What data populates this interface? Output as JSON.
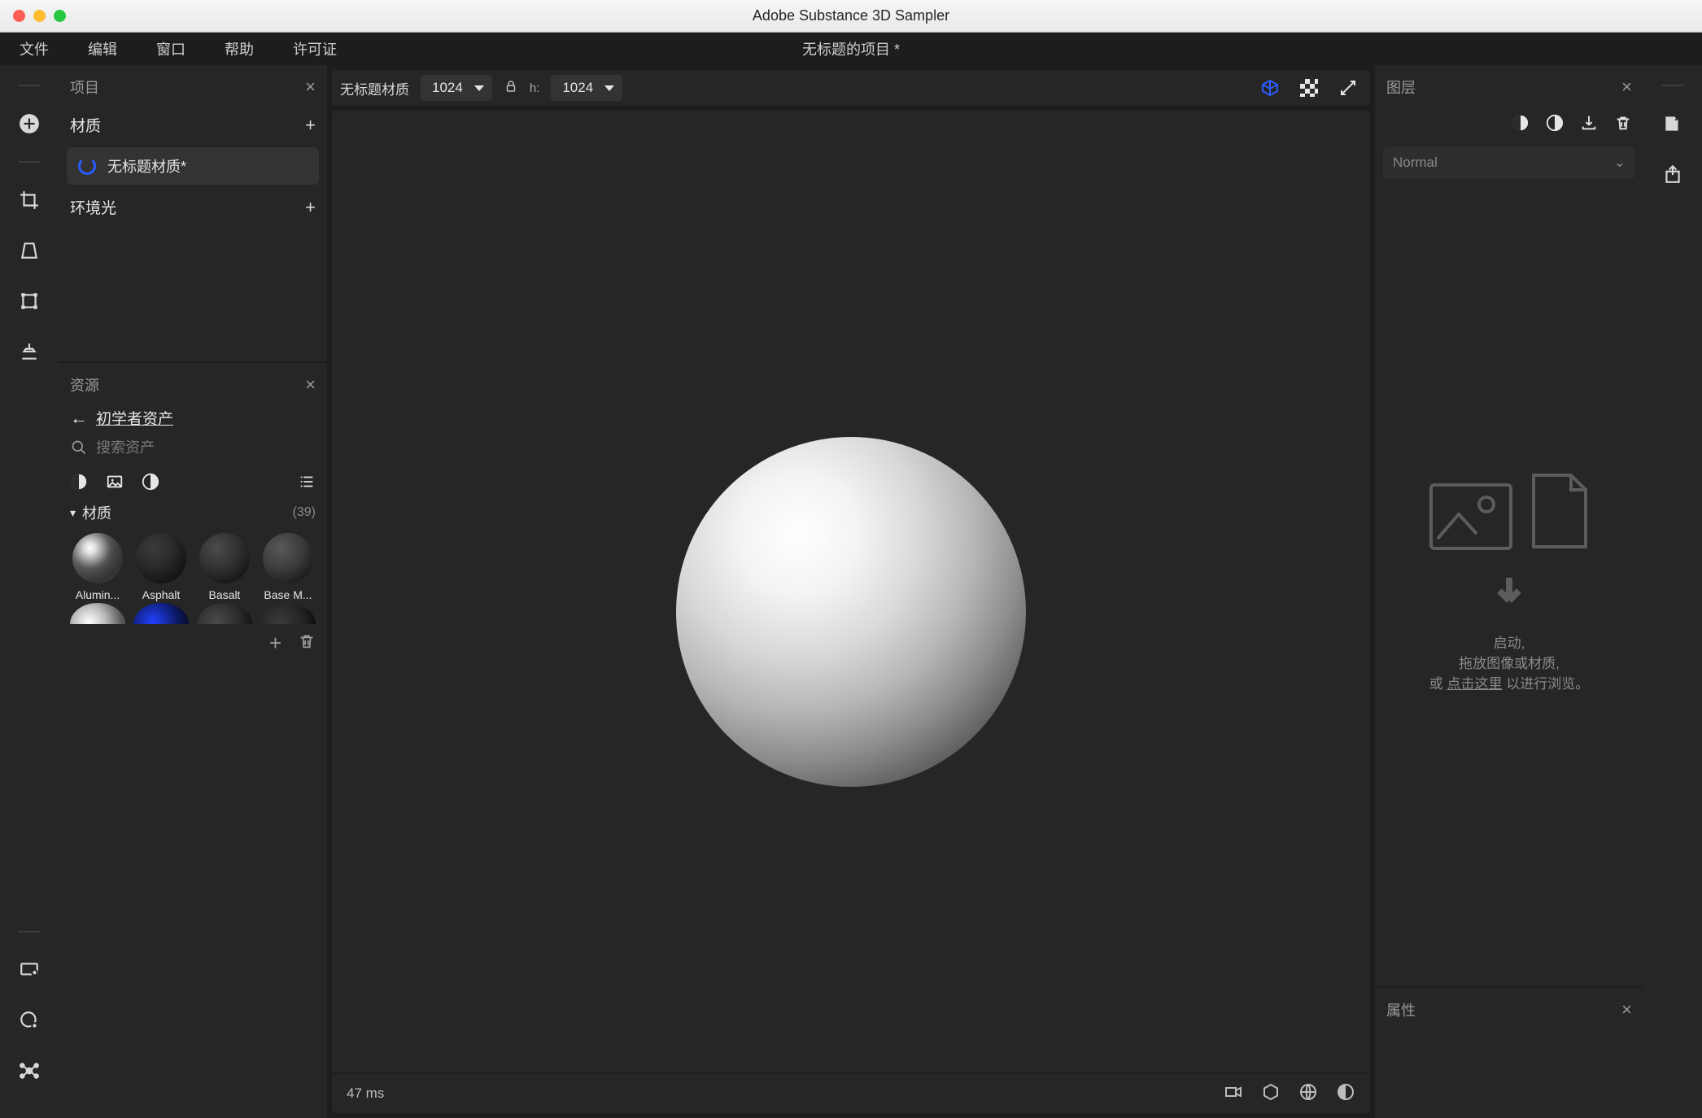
{
  "window": {
    "title": "Adobe Substance 3D Sampler"
  },
  "menubar": {
    "items": [
      "文件",
      "编辑",
      "窗口",
      "帮助",
      "许可证"
    ],
    "project_title": "无标题的项目 *"
  },
  "project_panel": {
    "title": "项目",
    "materials_header": "材质",
    "material_item": "无标题材质*",
    "env_header": "环境光"
  },
  "assets_panel": {
    "title": "资源",
    "back_label": "初学者资产",
    "search_placeholder": "搜索资产",
    "category_label": "材质",
    "category_count": "(39)",
    "thumbs": [
      "Alumin...",
      "Asphalt",
      "Basalt",
      "Base M..."
    ]
  },
  "viewport": {
    "material_name": "无标题材质",
    "link_locked": true,
    "width_value": "1024",
    "height_label": "h:",
    "height_value": "1024",
    "status_ms": "47 ms"
  },
  "layers_panel": {
    "title": "图层",
    "blend_mode": "Normal",
    "drop_text_1": "启动,",
    "drop_text_2": "拖放图像或材质,",
    "drop_text_3_pre": "或 ",
    "drop_text_3_link": "点击这里",
    "drop_text_3_post": " 以进行浏览。"
  },
  "properties_panel": {
    "title": "属性"
  }
}
